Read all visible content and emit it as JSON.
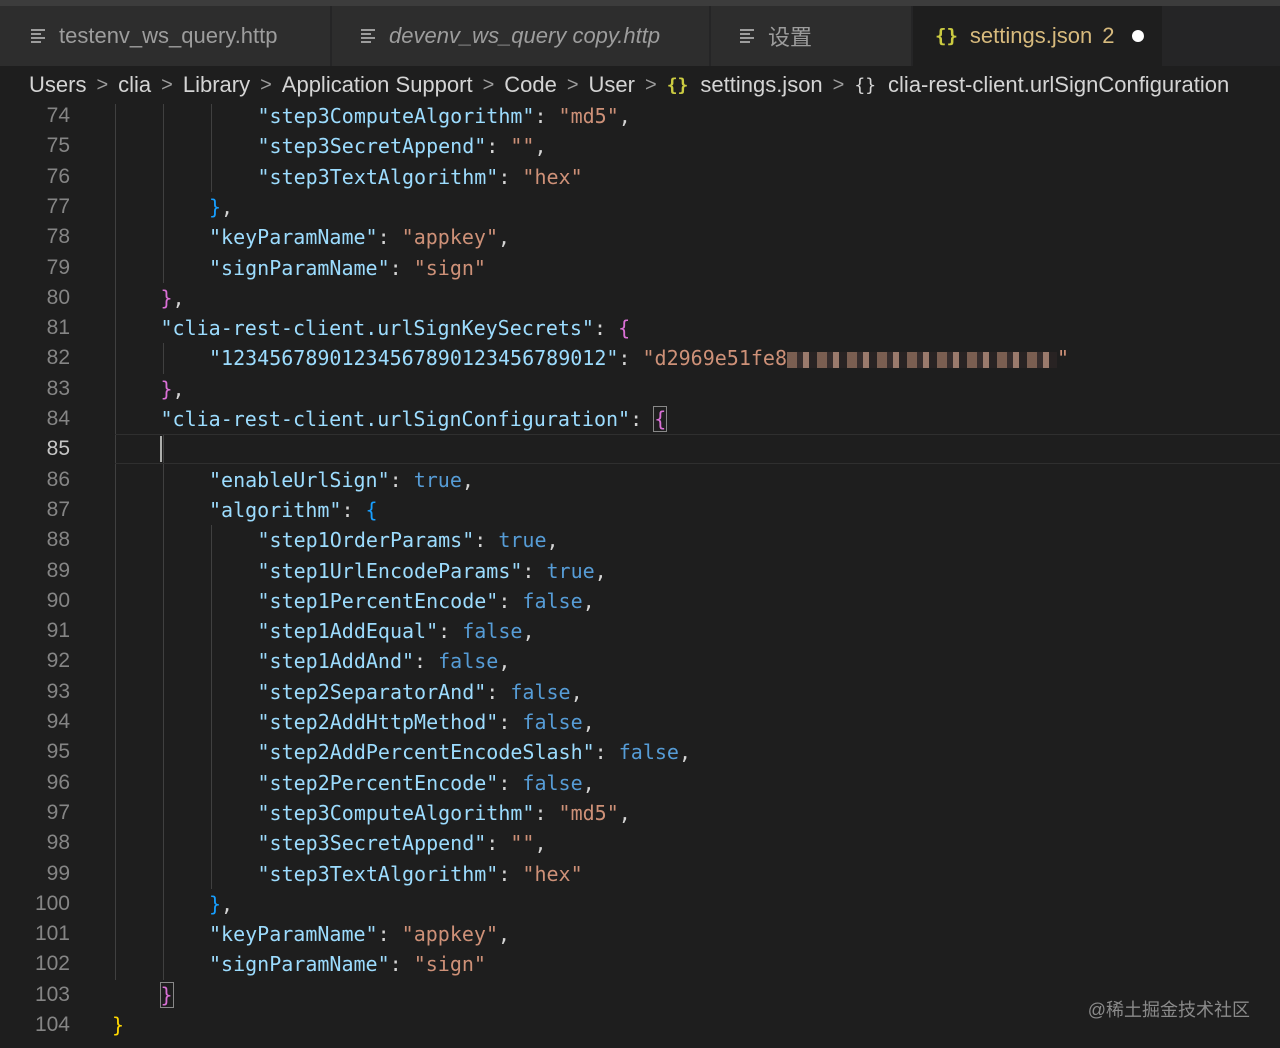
{
  "tabs": [
    {
      "label": "testenv_ws_query.http",
      "italic": false
    },
    {
      "label": "devenv_ws_query copy.http",
      "italic": true
    },
    {
      "label": "设置",
      "italic": false
    },
    {
      "label": "settings.json",
      "count": "2",
      "active": true,
      "modified": true
    }
  ],
  "breadcrumb": {
    "items": [
      "Users",
      "clia",
      "Library",
      "Application Support",
      "Code",
      "User",
      "settings.json",
      "clia-rest-client.urlSignConfiguration"
    ],
    "separator": ">",
    "braces_glyph": "{}"
  },
  "editor": {
    "current_line": 85,
    "lines": [
      {
        "n": "74",
        "code": "\"step3ComputeAlgorithm\": \"md5\","
      },
      {
        "n": "75",
        "code": "\"step3SecretAppend\": \"\","
      },
      {
        "n": "76",
        "code": "\"step3TextAlgorithm\": \"hex\""
      },
      {
        "n": "77",
        "code": "},"
      },
      {
        "n": "78",
        "code": "\"keyParamName\": \"appkey\","
      },
      {
        "n": "79",
        "code": "\"signParamName\": \"sign\""
      },
      {
        "n": "80",
        "code": "},"
      },
      {
        "n": "81",
        "code": "\"clia-rest-client.urlSignKeySecrets\": {"
      },
      {
        "n": "82",
        "code": "\"12345678901234567890123456789012\": \"d2969e51fe8"
      },
      {
        "n": "83",
        "code": "},"
      },
      {
        "n": "84",
        "code": "\"clia-rest-client.urlSignConfiguration\": {"
      },
      {
        "n": "85",
        "code": ""
      },
      {
        "n": "86",
        "code": "\"enableUrlSign\": true,"
      },
      {
        "n": "87",
        "code": "\"algorithm\": {"
      },
      {
        "n": "88",
        "code": "\"step1OrderParams\": true,"
      },
      {
        "n": "89",
        "code": "\"step1UrlEncodeParams\": true,"
      },
      {
        "n": "90",
        "code": "\"step1PercentEncode\": false,"
      },
      {
        "n": "91",
        "code": "\"step1AddEqual\": false,"
      },
      {
        "n": "92",
        "code": "\"step1AddAnd\": false,"
      },
      {
        "n": "93",
        "code": "\"step2SeparatorAnd\": false,"
      },
      {
        "n": "94",
        "code": "\"step2AddHttpMethod\": false,"
      },
      {
        "n": "95",
        "code": "\"step2AddPercentEncodeSlash\": false,"
      },
      {
        "n": "96",
        "code": "\"step2PercentEncode\": false,"
      },
      {
        "n": "97",
        "code": "\"step3ComputeAlgorithm\": \"md5\","
      },
      {
        "n": "98",
        "code": "\"step3SecretAppend\": \"\","
      },
      {
        "n": "99",
        "code": "\"step3TextAlgorithm\": \"hex\""
      },
      {
        "n": "100",
        "code": "},"
      },
      {
        "n": "101",
        "code": "\"keyParamName\": \"appkey\","
      },
      {
        "n": "102",
        "code": "\"signParamName\": \"sign\""
      },
      {
        "n": "103",
        "code": "}"
      },
      {
        "n": "104",
        "code": "}"
      }
    ]
  },
  "watermark": "@稀土掘金技术社区",
  "colors": {
    "background": "#1e1e1e",
    "tab_inactive": "#2d2d2d",
    "tab_active_text": "#d7ba7d",
    "json_key": "#9cdcfe",
    "json_string": "#ce9178",
    "json_boolean": "#569cd6",
    "bracket_level1": "#ffd700",
    "bracket_level2": "#da70d6",
    "bracket_level3": "#179fff"
  }
}
